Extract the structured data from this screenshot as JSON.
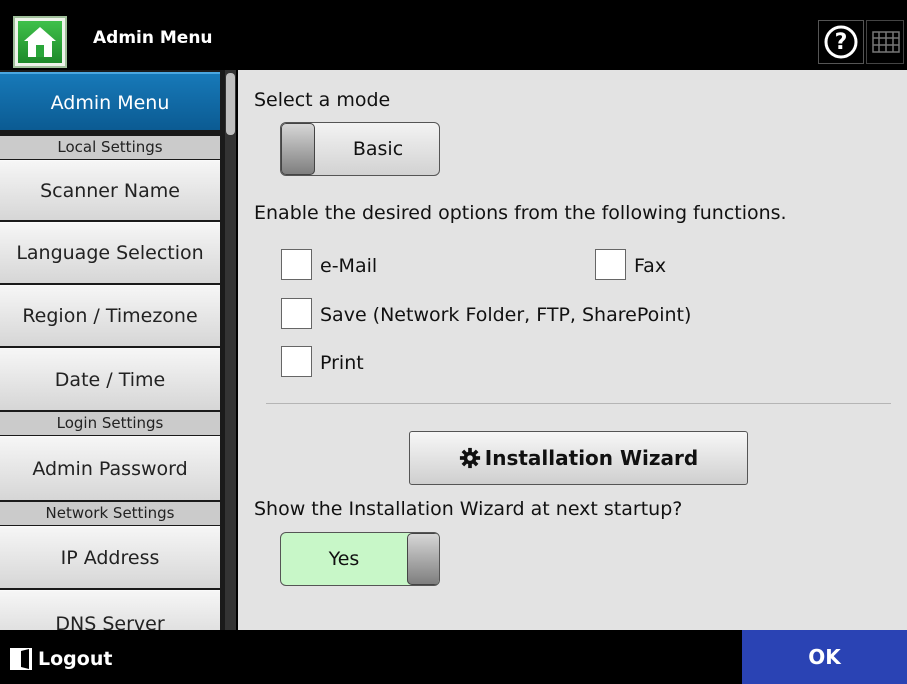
{
  "header": {
    "title": "Admin Menu",
    "help_glyph": "?"
  },
  "sidebar": {
    "active_item": "Admin Menu",
    "sections": [
      {
        "heading": "Local Settings",
        "items": [
          "Scanner Name",
          "Language Selection",
          "Region / Timezone",
          "Date / Time"
        ]
      },
      {
        "heading": "Login Settings",
        "items": [
          "Admin Password"
        ]
      },
      {
        "heading": "Network Settings",
        "items": [
          "IP Address",
          "DNS Server"
        ]
      }
    ]
  },
  "main": {
    "mode_label": "Select a mode",
    "mode_value": "Basic",
    "options_label": "Enable the desired options from the following functions.",
    "options": [
      {
        "label": "e-Mail",
        "checked": false
      },
      {
        "label": "Fax",
        "checked": false
      },
      {
        "label": "Save (Network Folder, FTP, SharePoint)",
        "checked": false
      },
      {
        "label": "Print",
        "checked": false
      }
    ],
    "wizard_button": "Installation Wizard",
    "wizard_question": "Show the Installation Wizard at next startup?",
    "wizard_toggle_value": "Yes"
  },
  "footer": {
    "logout_label": "Logout",
    "ok_label": "OK"
  },
  "colors": {
    "active_item": "#0b6aa8",
    "ok_button": "#2a43b4",
    "yes_toggle": "#c8f7c8",
    "home_icon": "#2aa63a"
  },
  "icons": [
    "home-icon",
    "help-icon",
    "keyboard-icon",
    "gear-icon",
    "logout-icon"
  ]
}
